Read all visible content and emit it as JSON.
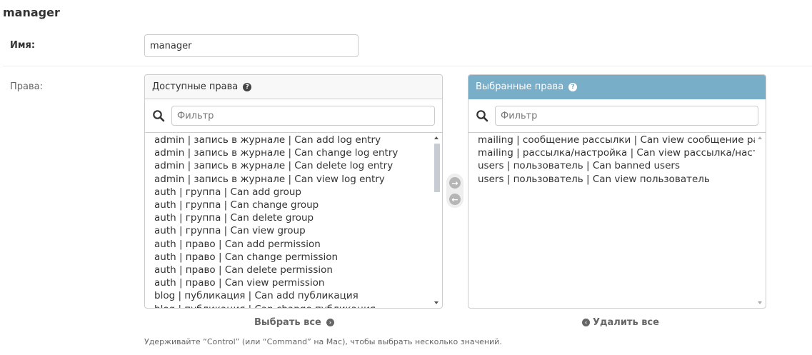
{
  "page": {
    "title": "manager"
  },
  "name_field": {
    "label": "Имя:",
    "value": "manager"
  },
  "permissions": {
    "label": "Права:",
    "available": {
      "title": "Доступные права",
      "help_icon": "question-circle-icon",
      "filter_placeholder": "Фильтр",
      "items": [
        "admin | запись в журнале | Can add log entry",
        "admin | запись в журнале | Can change log entry",
        "admin | запись в журнале | Can delete log entry",
        "admin | запись в журнале | Can view log entry",
        "auth | группа | Can add group",
        "auth | группа | Can change group",
        "auth | группа | Can delete group",
        "auth | группа | Can view group",
        "auth | право | Can add permission",
        "auth | право | Can change permission",
        "auth | право | Can delete permission",
        "auth | право | Can view permission",
        "blog | публикация | Can add публикация",
        "blog | публикация | Can change публикация"
      ]
    },
    "chosen": {
      "title": "Выбранные права",
      "help_icon": "question-circle-icon",
      "filter_placeholder": "Фильтр",
      "items": [
        "mailing | сообщение рассылки | Can view сообщение рассылки",
        "mailing | рассылка/настройка | Can view рассылка/настройка",
        "users | пользователь | Can banned users",
        "users | пользователь | Can view пользователь"
      ]
    },
    "choose_all_label": "Выбрать все",
    "remove_all_label": "Удалить все",
    "help_text": "Удерживайте “Control” (или “Command” на Mac), чтобы выбрать несколько значений."
  },
  "colors": {
    "chosen_header": "#79aec8",
    "border": "#cccccc",
    "text": "#333333"
  }
}
